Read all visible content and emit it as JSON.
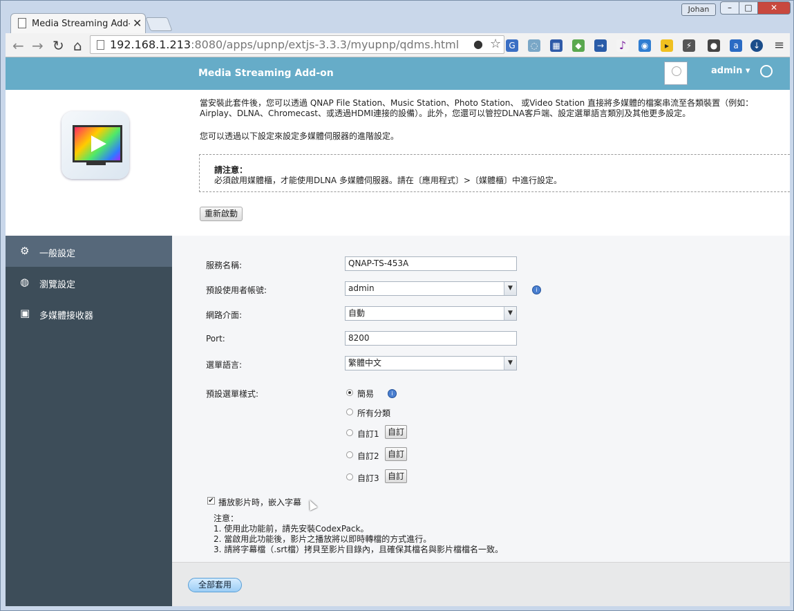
{
  "browser": {
    "tab_title": "Media Streaming Add-on",
    "profile": "Johan",
    "url_host": "192.168.1.213",
    "url_path": ":8080/apps/upnp/extjs-3.3.3/myupnp/qdms.html"
  },
  "app": {
    "title": "Media Streaming Add-on",
    "user": "admin ▾",
    "description": "當安裝此套件後，您可以透過 QNAP File Station、Music Station、Photo Station、 或Video Station 直接將多媒體的檔案串流至各類裝置（例如：Airplay、DLNA、Chromecast、或透過HDMI連接的設備）。此外，您還可以管控DLNA客戶端、設定選單語言類別及其他更多設定。",
    "description2": "您可以透過以下設定來設定多媒體伺服器的進階設定。",
    "notice_title": "請注意：",
    "notice_text": "必須啟用媒體櫃，才能使用DLNA 多媒體伺服器。請在〔應用程式〕>〔媒體櫃〕中進行設定。",
    "restart_label": "重新啟動"
  },
  "sidebar": {
    "items": [
      {
        "label": "一般設定",
        "icon": "gear-icon"
      },
      {
        "label": "瀏覽設定",
        "icon": "globe-icon"
      },
      {
        "label": "多媒體接收器",
        "icon": "media-player-icon"
      }
    ]
  },
  "form": {
    "service_name_label": "服務名稱:",
    "service_name_value": "QNAP-TS-453A",
    "default_user_label": "預設使用者帳號:",
    "default_user_value": "admin",
    "interface_label": "網路介面:",
    "interface_value": "自動",
    "port_label": "Port:",
    "port_value": "8200",
    "language_label": "選單語言:",
    "language_value": "繁體中文",
    "menu_style_label": "預設選單樣式:",
    "menu_styles": [
      "簡易",
      "所有分類",
      "自訂1",
      "自訂2",
      "自訂3"
    ],
    "custom_button_label": "自訂",
    "subtitle_label": "播放影片時，嵌入字幕",
    "note_title": "注意：",
    "note_lines": [
      "1. 使用此功能前，請先安裝CodexPack。",
      "2. 當啟用此功能後，影片之播放將以即時轉檔的方式進行。",
      "3. 請將字幕檔（.srt檔）拷貝至影片目錄內，且確保其檔名與影片檔檔名一致。"
    ],
    "apply_label": "全部套用"
  }
}
